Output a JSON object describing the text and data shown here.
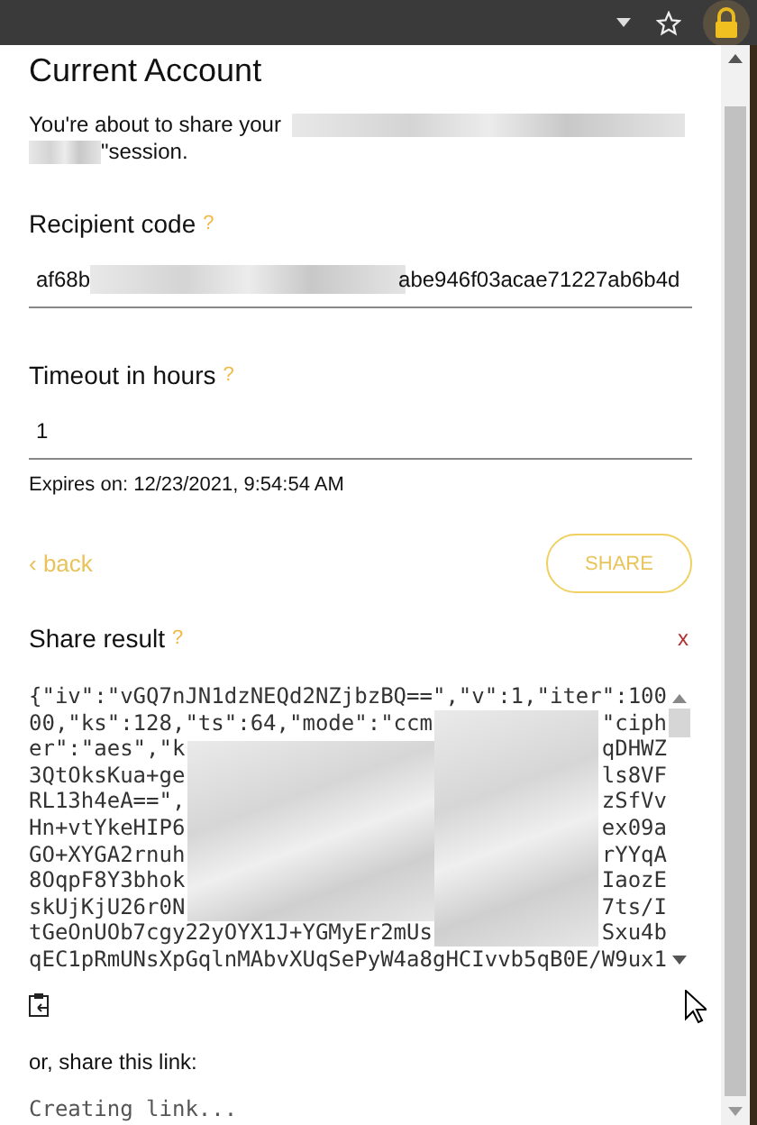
{
  "title": "Current Account",
  "intro": {
    "before": "You're about to share your",
    "after": "\"session."
  },
  "recipient": {
    "label": "Recipient code",
    "help": "?",
    "value_start": "af68b",
    "value_end": "abe946f03acae71227ab6b4d"
  },
  "timeout": {
    "label": "Timeout in hours",
    "help": "?",
    "value": "1"
  },
  "expires": "Expires on: 12/23/2021, 9:54:54 AM",
  "back_link": "‹ back",
  "share_button": "SHARE",
  "result": {
    "label": "Share result",
    "help": "?",
    "close": "x",
    "lines": [
      {
        "start": "{\"iv\":\"vGQ7nJN1dzNEQd2NZjbzBQ==\",\"v\":1,\"iter\":100"
      },
      {
        "start": "00,\"ks\":128,\"ts\":64,\"mode\":\"ccm",
        "end": "\"ciph"
      },
      {
        "start": "er\":\"aes\",\"k",
        "end": "qDHWZ"
      },
      {
        "start": "3QtOksKua+ge",
        "end": "ls8VF"
      },
      {
        "start": "RL13h4eA==\",",
        "end": "zSfVv"
      },
      {
        "start": "Hn+vtYkeHIP6",
        "end": "ex09a"
      },
      {
        "start": "GO+XYGA2rnuh",
        "end": "rYYqA"
      },
      {
        "start": "8OqpF8Y3bhok",
        "end": "IaozE"
      },
      {
        "start": "skUjKjU26r0N",
        "end": "7ts/I"
      },
      {
        "start": "tGeOnUOb7cgy22yOYX1J+YGMyEr2mUs",
        "end": "Sxu4b"
      },
      {
        "start": "qEC1pRmUNsXpGqlnMAbvXUqSePyW4a8gHCIvvb5qB0E/W9ux1"
      }
    ]
  },
  "link": {
    "label": "or, share this link:",
    "status": "Creating link..."
  }
}
